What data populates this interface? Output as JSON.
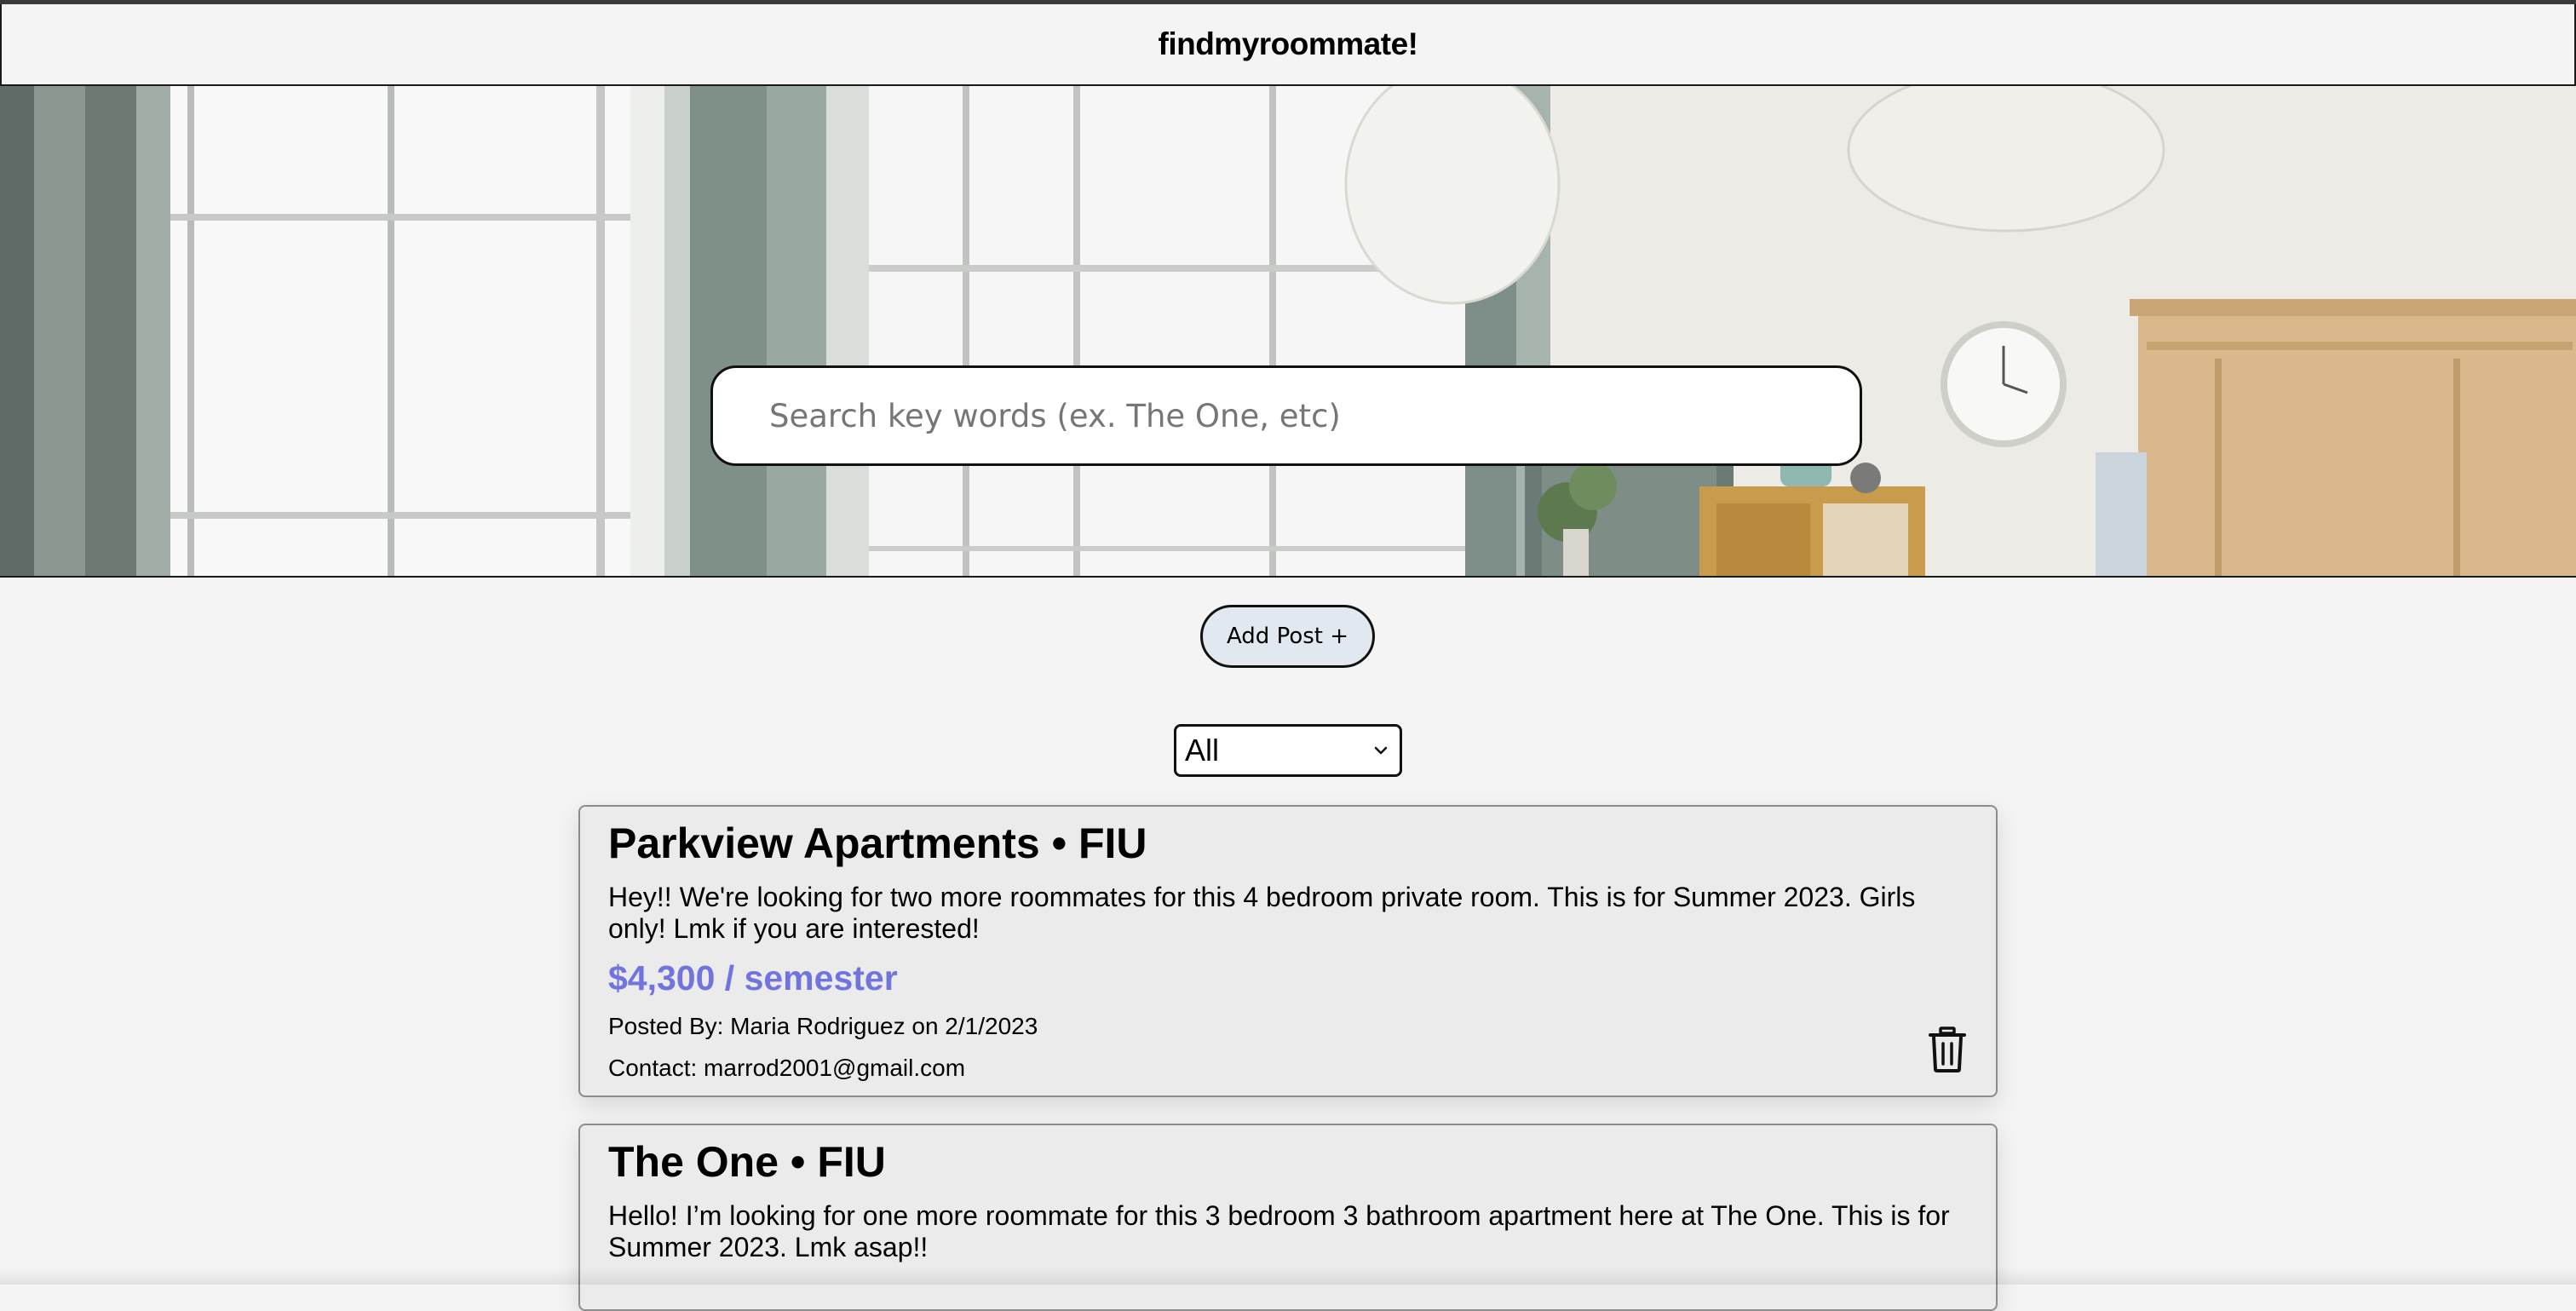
{
  "header": {
    "brand": "findmyroommate!"
  },
  "hero": {
    "image": "bedroom-interior-photo",
    "search": {
      "placeholder": "Search key words (ex. The One, etc)",
      "value": ""
    }
  },
  "actions": {
    "add_post_label": "Add Post +"
  },
  "filter": {
    "selected": "All"
  },
  "posts": [
    {
      "title": "Parkview Apartments • FIU",
      "description": "Hey!! We're looking for two more roommates for this 4 bedroom private room. This is for Summer 2023. Girls only! Lmk if you are interested!",
      "price": "$4,300 / semester",
      "posted": "Posted By: Maria Rodriguez on 2/1/2023",
      "contact": "Contact: marrod2001@gmail.com",
      "delete_icon": "trash-icon"
    },
    {
      "title": "The One • FIU",
      "description": "Hello! I’m looking for one more roommate for this 3 bedroom 3 bathroom apartment here at The One. This is for Summer 2023. Lmk asap!!"
    }
  ],
  "colors": {
    "background": "#f4f4f4",
    "price": "#7174dd",
    "add_post_bg": "#e2e8ef",
    "card_bg": "#ebebeb"
  }
}
